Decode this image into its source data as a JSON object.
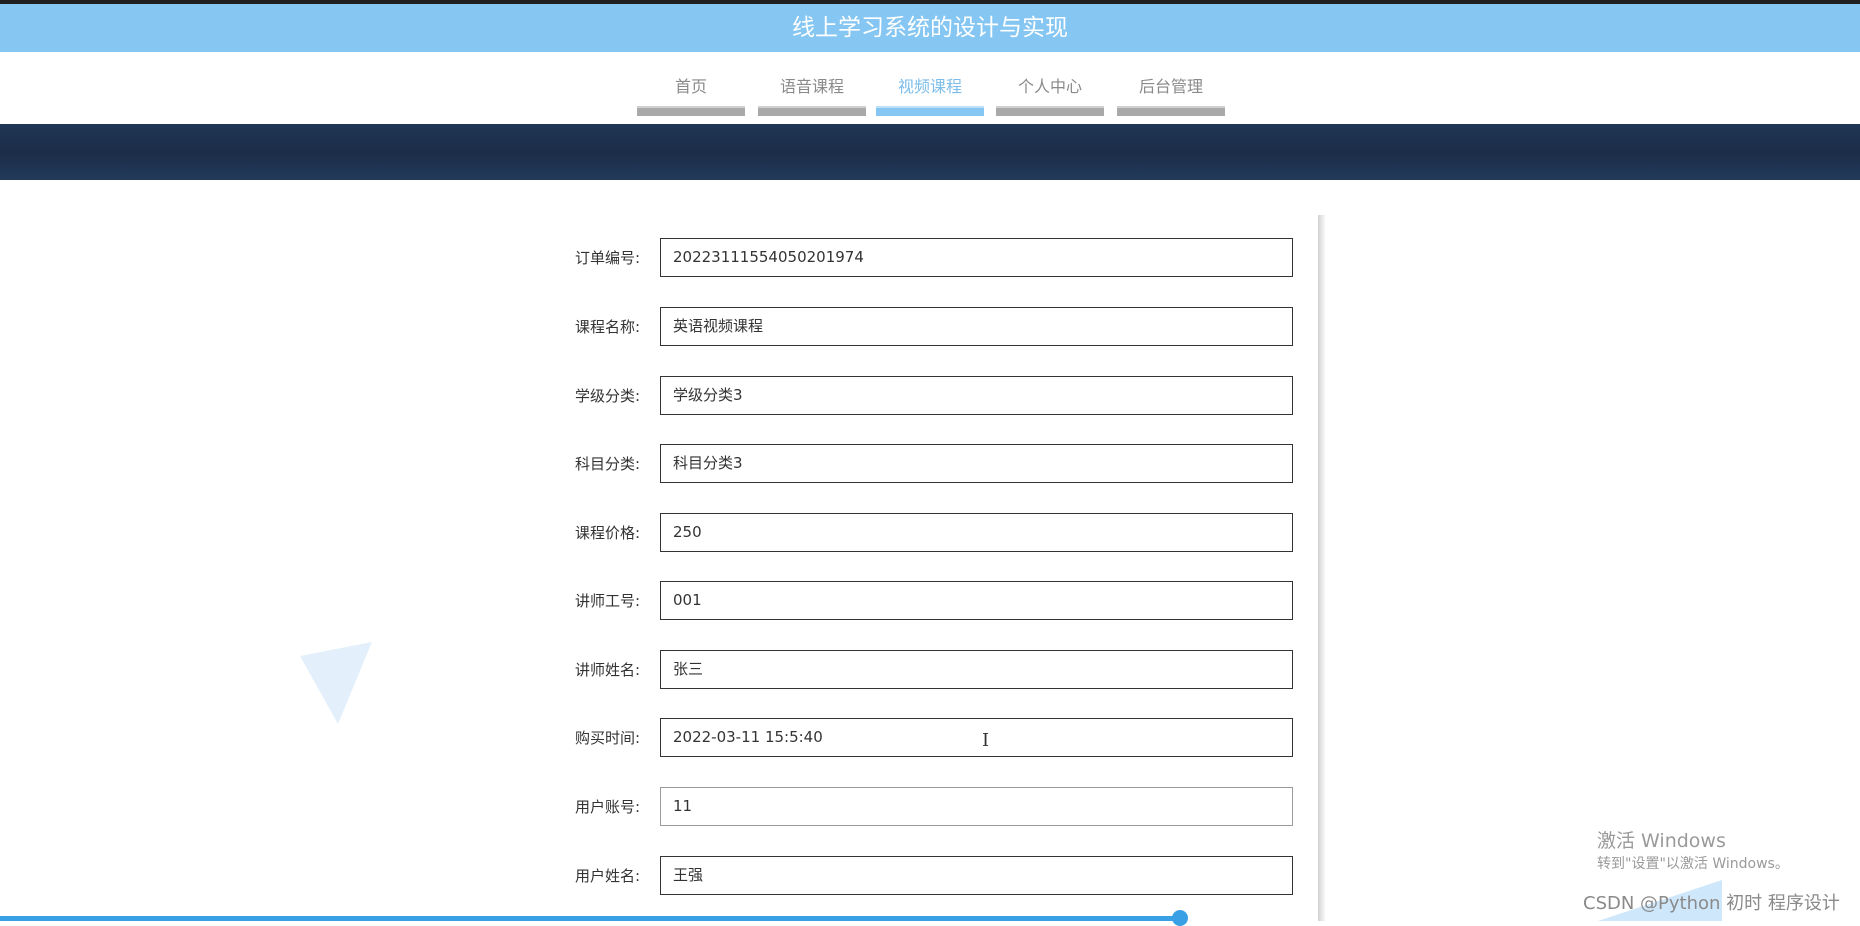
{
  "app": {
    "title": "线上学习系统的设计与实现"
  },
  "nav": {
    "items": [
      {
        "label": "首页",
        "active": false
      },
      {
        "label": "语音课程",
        "active": false
      },
      {
        "label": "视频课程",
        "active": true
      },
      {
        "label": "个人中心",
        "active": false
      },
      {
        "label": "后台管理",
        "active": false
      }
    ]
  },
  "form": {
    "fields": [
      {
        "label": "订单编号:",
        "value": "20223111554050201974"
      },
      {
        "label": "课程名称:",
        "value": "英语视频课程"
      },
      {
        "label": "学级分类:",
        "value": "学级分类3"
      },
      {
        "label": "科目分类:",
        "value": "科目分类3"
      },
      {
        "label": "课程价格:",
        "value": "250"
      },
      {
        "label": "讲师工号:",
        "value": "001"
      },
      {
        "label": "讲师姓名:",
        "value": "张三"
      },
      {
        "label": "购买时间:",
        "value": "2022-03-11 15:5:40"
      },
      {
        "label": "用户账号:",
        "value": "11"
      },
      {
        "label": "用户姓名:",
        "value": "王强"
      }
    ]
  },
  "overlay": {
    "activation_title": "激活 Windows",
    "activation_hint": "转到\"设置\"以激活 Windows。",
    "credit": "CSDN @Python 初时 程序设计"
  },
  "colors": {
    "accent": "#85c6f2",
    "banner": "#1e3350",
    "progress": "#3aa0e6"
  }
}
